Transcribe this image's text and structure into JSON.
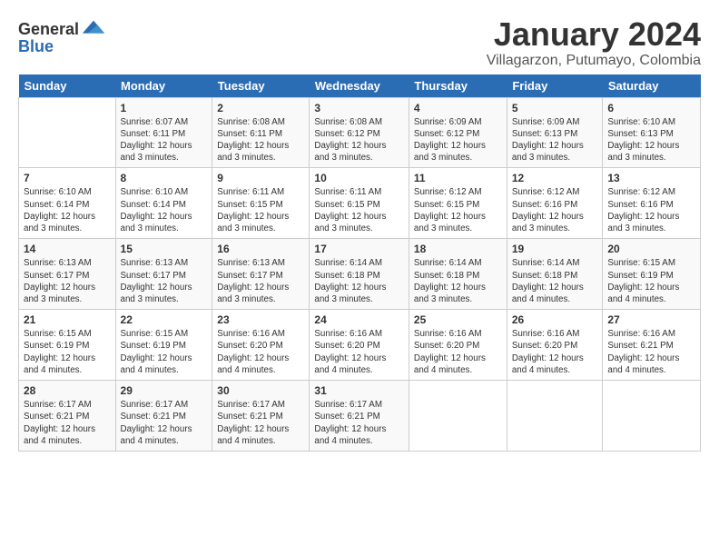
{
  "header": {
    "logo_general": "General",
    "logo_blue": "Blue",
    "month_year": "January 2024",
    "location": "Villagarzon, Putumayo, Colombia"
  },
  "days_of_week": [
    "Sunday",
    "Monday",
    "Tuesday",
    "Wednesday",
    "Thursday",
    "Friday",
    "Saturday"
  ],
  "weeks": [
    [
      {
        "day": "",
        "info": ""
      },
      {
        "day": "1",
        "info": "Sunrise: 6:07 AM\nSunset: 6:11 PM\nDaylight: 12 hours\nand 3 minutes."
      },
      {
        "day": "2",
        "info": "Sunrise: 6:08 AM\nSunset: 6:11 PM\nDaylight: 12 hours\nand 3 minutes."
      },
      {
        "day": "3",
        "info": "Sunrise: 6:08 AM\nSunset: 6:12 PM\nDaylight: 12 hours\nand 3 minutes."
      },
      {
        "day": "4",
        "info": "Sunrise: 6:09 AM\nSunset: 6:12 PM\nDaylight: 12 hours\nand 3 minutes."
      },
      {
        "day": "5",
        "info": "Sunrise: 6:09 AM\nSunset: 6:13 PM\nDaylight: 12 hours\nand 3 minutes."
      },
      {
        "day": "6",
        "info": "Sunrise: 6:10 AM\nSunset: 6:13 PM\nDaylight: 12 hours\nand 3 minutes."
      }
    ],
    [
      {
        "day": "7",
        "info": "Sunrise: 6:10 AM\nSunset: 6:14 PM\nDaylight: 12 hours\nand 3 minutes."
      },
      {
        "day": "8",
        "info": "Sunrise: 6:10 AM\nSunset: 6:14 PM\nDaylight: 12 hours\nand 3 minutes."
      },
      {
        "day": "9",
        "info": "Sunrise: 6:11 AM\nSunset: 6:15 PM\nDaylight: 12 hours\nand 3 minutes."
      },
      {
        "day": "10",
        "info": "Sunrise: 6:11 AM\nSunset: 6:15 PM\nDaylight: 12 hours\nand 3 minutes."
      },
      {
        "day": "11",
        "info": "Sunrise: 6:12 AM\nSunset: 6:15 PM\nDaylight: 12 hours\nand 3 minutes."
      },
      {
        "day": "12",
        "info": "Sunrise: 6:12 AM\nSunset: 6:16 PM\nDaylight: 12 hours\nand 3 minutes."
      },
      {
        "day": "13",
        "info": "Sunrise: 6:12 AM\nSunset: 6:16 PM\nDaylight: 12 hours\nand 3 minutes."
      }
    ],
    [
      {
        "day": "14",
        "info": "Sunrise: 6:13 AM\nSunset: 6:17 PM\nDaylight: 12 hours\nand 3 minutes."
      },
      {
        "day": "15",
        "info": "Sunrise: 6:13 AM\nSunset: 6:17 PM\nDaylight: 12 hours\nand 3 minutes."
      },
      {
        "day": "16",
        "info": "Sunrise: 6:13 AM\nSunset: 6:17 PM\nDaylight: 12 hours\nand 3 minutes."
      },
      {
        "day": "17",
        "info": "Sunrise: 6:14 AM\nSunset: 6:18 PM\nDaylight: 12 hours\nand 3 minutes."
      },
      {
        "day": "18",
        "info": "Sunrise: 6:14 AM\nSunset: 6:18 PM\nDaylight: 12 hours\nand 3 minutes."
      },
      {
        "day": "19",
        "info": "Sunrise: 6:14 AM\nSunset: 6:18 PM\nDaylight: 12 hours\nand 4 minutes."
      },
      {
        "day": "20",
        "info": "Sunrise: 6:15 AM\nSunset: 6:19 PM\nDaylight: 12 hours\nand 4 minutes."
      }
    ],
    [
      {
        "day": "21",
        "info": "Sunrise: 6:15 AM\nSunset: 6:19 PM\nDaylight: 12 hours\nand 4 minutes."
      },
      {
        "day": "22",
        "info": "Sunrise: 6:15 AM\nSunset: 6:19 PM\nDaylight: 12 hours\nand 4 minutes."
      },
      {
        "day": "23",
        "info": "Sunrise: 6:16 AM\nSunset: 6:20 PM\nDaylight: 12 hours\nand 4 minutes."
      },
      {
        "day": "24",
        "info": "Sunrise: 6:16 AM\nSunset: 6:20 PM\nDaylight: 12 hours\nand 4 minutes."
      },
      {
        "day": "25",
        "info": "Sunrise: 6:16 AM\nSunset: 6:20 PM\nDaylight: 12 hours\nand 4 minutes."
      },
      {
        "day": "26",
        "info": "Sunrise: 6:16 AM\nSunset: 6:20 PM\nDaylight: 12 hours\nand 4 minutes."
      },
      {
        "day": "27",
        "info": "Sunrise: 6:16 AM\nSunset: 6:21 PM\nDaylight: 12 hours\nand 4 minutes."
      }
    ],
    [
      {
        "day": "28",
        "info": "Sunrise: 6:17 AM\nSunset: 6:21 PM\nDaylight: 12 hours\nand 4 minutes."
      },
      {
        "day": "29",
        "info": "Sunrise: 6:17 AM\nSunset: 6:21 PM\nDaylight: 12 hours\nand 4 minutes."
      },
      {
        "day": "30",
        "info": "Sunrise: 6:17 AM\nSunset: 6:21 PM\nDaylight: 12 hours\nand 4 minutes."
      },
      {
        "day": "31",
        "info": "Sunrise: 6:17 AM\nSunset: 6:21 PM\nDaylight: 12 hours\nand 4 minutes."
      },
      {
        "day": "",
        "info": ""
      },
      {
        "day": "",
        "info": ""
      },
      {
        "day": "",
        "info": ""
      }
    ]
  ]
}
